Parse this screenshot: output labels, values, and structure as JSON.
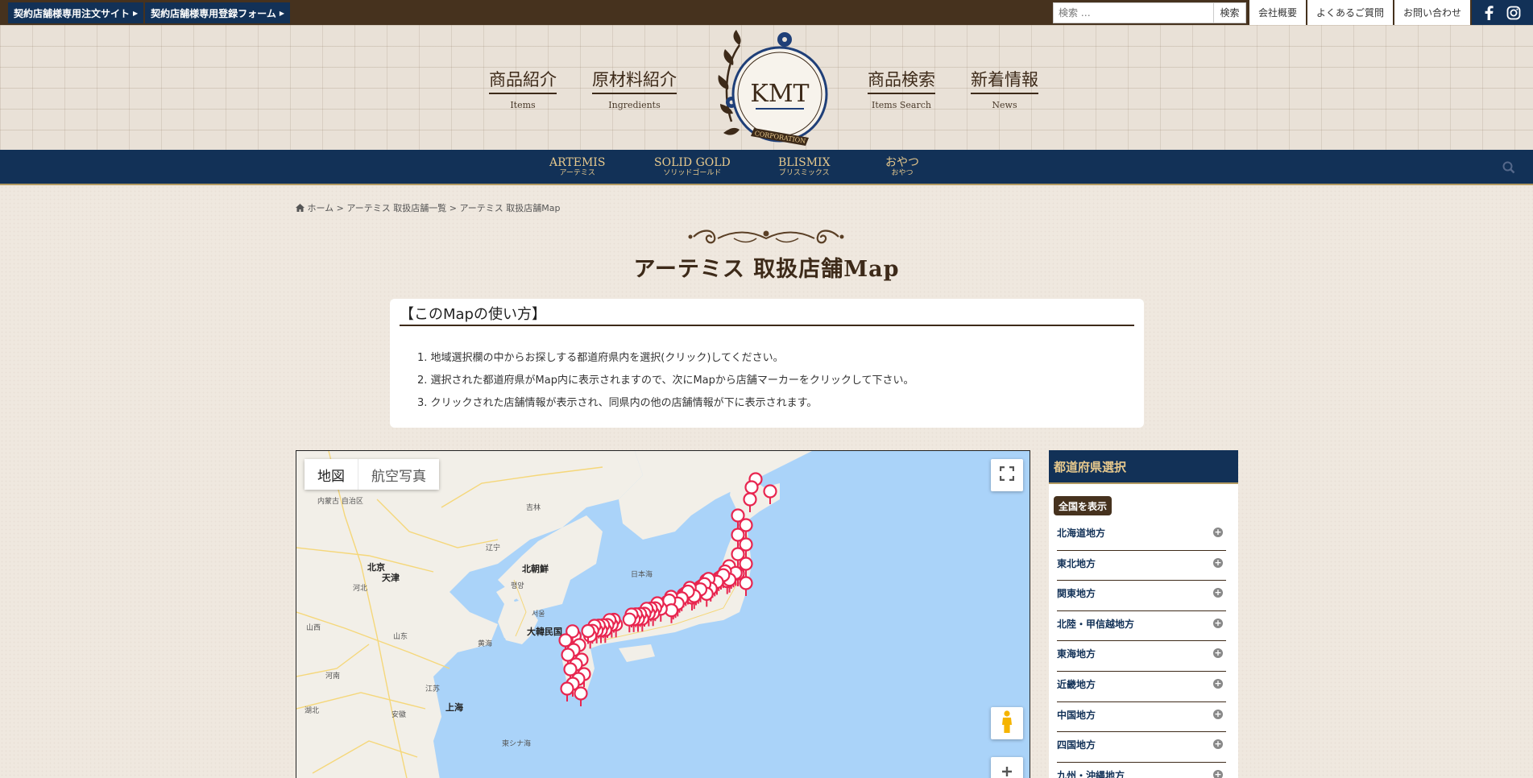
{
  "topbar": {
    "links": [
      "契約店舗様専用注文サイト",
      "契約店舗様専用登録フォーム"
    ],
    "search_placeholder": "検索 …",
    "search_button": "検索",
    "util_links": [
      "会社概要",
      "よくあるご質問",
      "お問い合わせ"
    ]
  },
  "header": {
    "nav": [
      {
        "jp": "商品紹介",
        "en": "Items"
      },
      {
        "jp": "原材料紹介",
        "en": "Ingredients"
      },
      {
        "jp": "商品検索",
        "en": "Items Search"
      },
      {
        "jp": "新着情報",
        "en": "News"
      }
    ],
    "logo_text": "KMT",
    "logo_sub": "CORPORATION"
  },
  "brands": [
    {
      "name": "ARTEMIS",
      "kana": "アーテミス"
    },
    {
      "name": "SOLID GOLD",
      "kana": "ソリッドゴールド"
    },
    {
      "name": "BLISMIX",
      "kana": "ブリスミックス"
    },
    {
      "name": "おやつ",
      "kana": "おやつ"
    }
  ],
  "breadcrumb": {
    "home": "ホーム",
    "sep": " > ",
    "list": "アーテミス 取扱店舗一覧",
    "current": "アーテミス 取扱店舗Map"
  },
  "page_title": "アーテミス 取扱店舗Map",
  "howto": {
    "title": "【このMapの使い方】",
    "steps": [
      "1. 地域選択欄の中からお探しする都道府県内を選択(クリック)してください。",
      "2. 選択された都道府県がMap内に表示されますので、次にMapから店舗マーカーをクリックして下さい。",
      "3. クリックされた店舗情報が表示され、同県内の他の店舗情報が下に表示されます。"
    ]
  },
  "map": {
    "type_map": "地図",
    "type_satellite": "航空写真",
    "labels": {
      "beijing": "北京",
      "tianjin": "天津",
      "north_korea": "北朝鮮",
      "pyongyang": "평양",
      "seoul": "서울",
      "south_korea": "大韓民国",
      "sea_of_japan": "日本海",
      "yellow_sea": "黄海",
      "shanghai": "上海",
      "east_china_sea": "東シナ海",
      "jilin": "吉林",
      "liaoning": "辽宁",
      "inner_mongolia": "内蒙古\n自治区",
      "hebei": "河北",
      "shanxi": "山西",
      "shandong": "山东",
      "henan": "河南",
      "jiangsu": "江苏",
      "anhui": "安徽",
      "hubei": "湖北"
    },
    "colors": {
      "sea": "#aad3f9",
      "land": "#f2efe8",
      "marker": "#e8254f"
    }
  },
  "sidebar": {
    "title": "都道府県選択",
    "show_all": "全国を表示",
    "regions": [
      "北海道地方",
      "東北地方",
      "関東地方",
      "北陸・甲信越地方",
      "東海地方",
      "近畿地方",
      "中国地方",
      "四国地方",
      "九州・沖縄地方"
    ]
  }
}
